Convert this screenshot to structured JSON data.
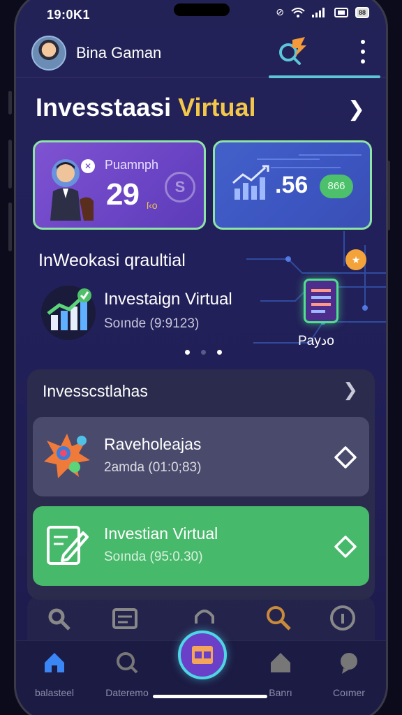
{
  "status": {
    "time": "19:0K1",
    "battery": "88"
  },
  "header": {
    "user_name": "Bina Gaman"
  },
  "page": {
    "title_part1": "Invesstaasi ",
    "title_part2": "Virtual"
  },
  "cards": [
    {
      "label": "Puamnph",
      "value": "29",
      "small": "ſ‹o",
      "coin": "S"
    },
    {
      "value": ".56",
      "pill": "866"
    }
  ],
  "section": {
    "heading": "InWeokasi qraultial",
    "feature_title": "Investaign Virtual",
    "feature_sub": "Soınde (9:9123)",
    "tablet_label": "Payدo"
  },
  "list": {
    "header": "Invesscstlahas",
    "items": [
      {
        "title": "Raveholeajas",
        "sub": "2amda (01:0;83)"
      },
      {
        "title": "Investian Virtual",
        "sub": "Soında (95:0.30)"
      }
    ]
  },
  "nav": {
    "items": [
      {
        "label": "balasteel"
      },
      {
        "label": "Dateremo"
      },
      {
        "label": "Banrı"
      },
      {
        "label": "Coımer"
      }
    ]
  },
  "colors": {
    "accent": "#f3c84a",
    "brand_purple": "#6a44c4",
    "green": "#47b96a",
    "cyan": "#5cc6d6"
  }
}
